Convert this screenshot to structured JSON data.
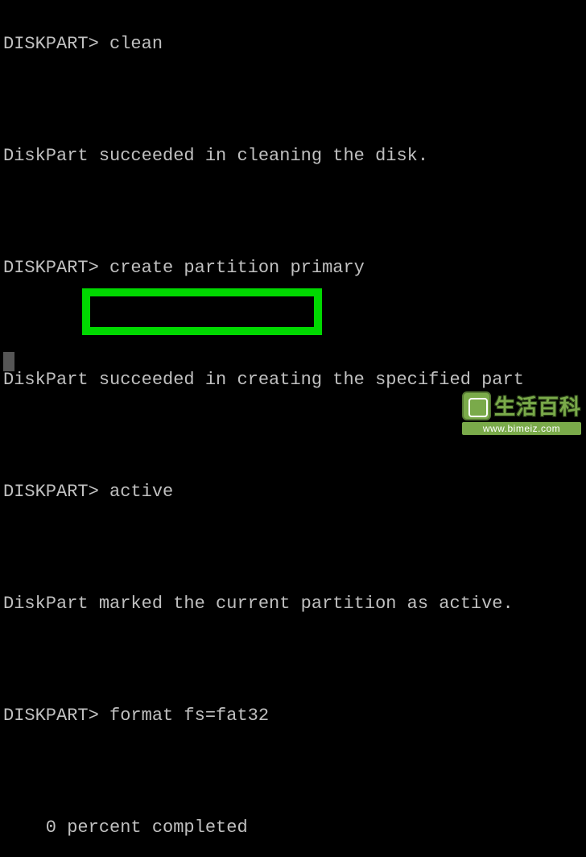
{
  "terminal": {
    "lines": [
      {
        "type": "text",
        "text": "DISKPART> clean"
      },
      {
        "type": "blank"
      },
      {
        "type": "text",
        "text": "DiskPart succeeded in cleaning the disk."
      },
      {
        "type": "blank"
      },
      {
        "type": "text",
        "text": "DISKPART> create partition primary"
      },
      {
        "type": "blank"
      },
      {
        "type": "text",
        "text": "DiskPart succeeded in creating the specified part"
      },
      {
        "type": "blank"
      },
      {
        "type": "text",
        "text": "DISKPART> active"
      },
      {
        "type": "blank"
      },
      {
        "type": "text",
        "text": "DiskPart marked the current partition as active."
      },
      {
        "type": "blank"
      },
      {
        "type": "text",
        "text": "DISKPART> format fs=fat32"
      },
      {
        "type": "blank"
      },
      {
        "type": "text",
        "text": "    0 percent completed"
      }
    ],
    "highlighted_command": "format fs=fat32",
    "progress_percent": 0
  },
  "watermark": {
    "text": "生活百科",
    "url": "www.bimeiz.com"
  }
}
